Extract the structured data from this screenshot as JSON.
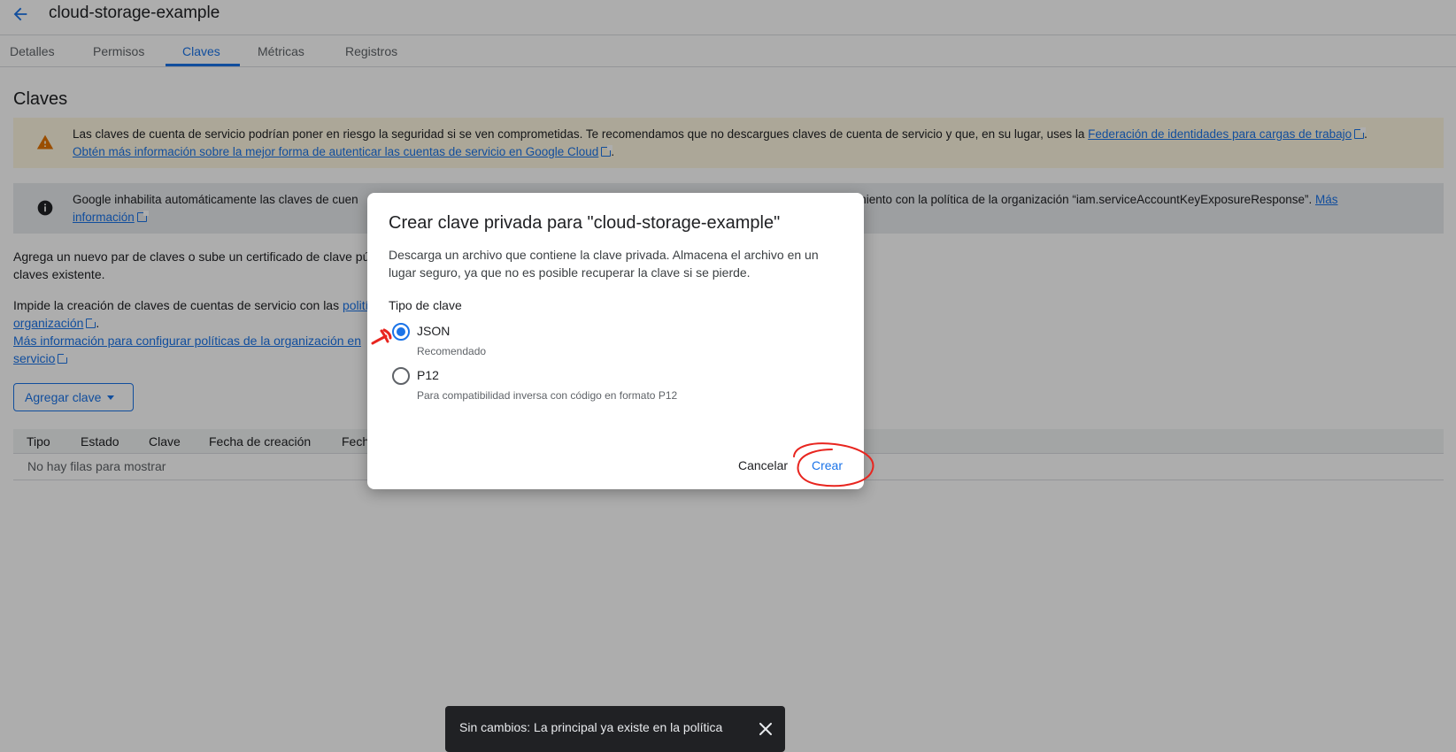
{
  "header": {
    "title": "cloud-storage-example",
    "back_icon": "arrow-back-icon"
  },
  "tabs": [
    {
      "label": "Detalles"
    },
    {
      "label": "Permisos"
    },
    {
      "label": "Claves"
    },
    {
      "label": "Métricas"
    },
    {
      "label": "Registros"
    }
  ],
  "active_tab": "Claves",
  "section": {
    "title": "Claves"
  },
  "warning_banner": {
    "icon": "warning-icon",
    "text": "Las claves de cuenta de servicio podrían poner en riesgo la seguridad si se ven comprometidas. Te recomendamos que no descargues claves de cuenta de servicio y que, en su lugar, uses la ",
    "link1": "Federación de identidades para cargas de trabajo",
    "sep": ".",
    "link2": "Obtén más información sobre la mejor forma de autenticar las cuentas de servicio en Google Cloud",
    "end": "."
  },
  "info_banner": {
    "icon": "info-icon",
    "text_left": "Google inhabilita automáticamente las claves de cuen",
    "text_right": "rtamiento con la política de la organización “iam.serviceAccountKeyExposureResponse”. ",
    "link_a": "Más",
    "link_b": "información"
  },
  "intro": {
    "line1": "Agrega un nuevo par de claves o sube un certificado de clave púb",
    "line2": "claves existente."
  },
  "policy": {
    "line1_text": "Impide la creación de claves de cuentas de servicio con las ",
    "line1_link": "polití",
    "line2_link": "organización",
    "line2_end": ".",
    "line3_link": "Más información para configurar políticas de la organización en",
    "line4_link": "servicio"
  },
  "add_key_button": {
    "label": "Agregar clave",
    "icon": "caret-down-icon"
  },
  "table": {
    "columns": [
      "Tipo",
      "Estado",
      "Clave",
      "Fecha de creación",
      "Fech"
    ],
    "empty_message": "No hay filas para mostrar"
  },
  "dialog": {
    "title": "Crear clave privada para \"cloud-storage-example\"",
    "description": "Descarga un archivo que contiene la clave privada. Almacena el archivo en un lugar seguro, ya que no es posible recuperar la clave si se pierde.",
    "key_type_label": "Tipo de clave",
    "options": [
      {
        "label": "JSON",
        "sublabel": "Recomendado",
        "selected": true
      },
      {
        "label": "P12",
        "sublabel": "Para compatibilidad inversa con código en formato P12",
        "selected": false
      }
    ],
    "cancel_label": "Cancelar",
    "create_label": "Crear"
  },
  "snackbar": {
    "message": "Sin cambios: La principal ya existe en la política",
    "close_icon": "close-icon"
  },
  "colors": {
    "accent": "#1a73e8",
    "warning": "#e37400",
    "annotation": "#e8251f"
  }
}
